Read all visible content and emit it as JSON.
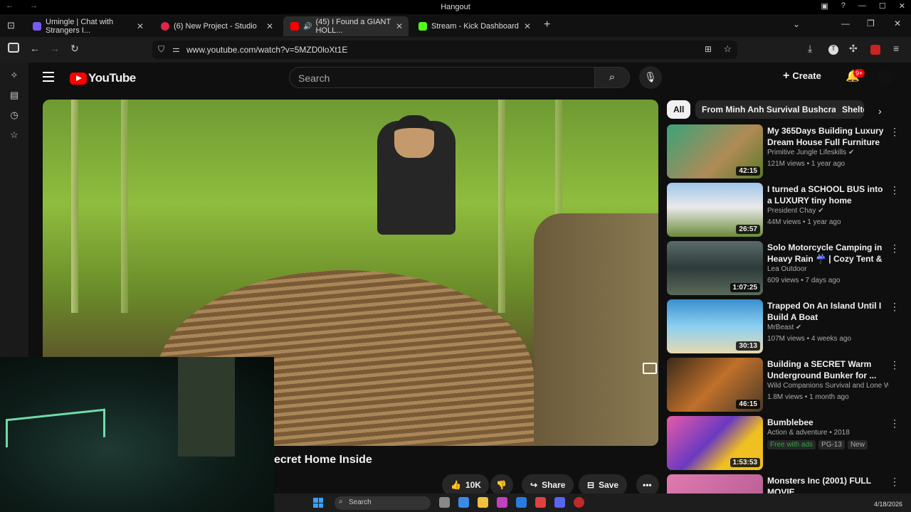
{
  "window": {
    "title": "Hangout"
  },
  "tabs": [
    {
      "label": "Umingle | Chat with Strangers I...",
      "color": "#7a5af5"
    },
    {
      "label": "(6) New Project - Studio",
      "color": "#e0244a"
    },
    {
      "label": "(45) I Found a GIANT HOLL...",
      "color": "#ff0000"
    },
    {
      "label": "Stream - Kick Dashboard",
      "color": "#53fc18"
    }
  ],
  "address": {
    "url": "www.youtube.com/watch?v=5MZD0loXt1E"
  },
  "youtube": {
    "logo_text": "YouTube",
    "search_placeholder": "Search",
    "create_label": "Create",
    "notification_count": "9+"
  },
  "video": {
    "title_partial": "ecret Home Inside",
    "like_count": "10K",
    "share_label": "Share",
    "save_label": "Save"
  },
  "chips": [
    "All",
    "From Minh Anh Survival Bushcraft",
    "Shelte"
  ],
  "recommendations": [
    {
      "title": "My 365Days Building Luxury Dream House Full Furniture an...",
      "channel": "Primitive Jungle Lifeskills",
      "verified": true,
      "meta": "121M views • 1 year ago",
      "duration": "42:15"
    },
    {
      "title": "I turned a SCHOOL BUS into a LUXURY tiny home",
      "channel": "President Chay",
      "verified": true,
      "meta": "44M views • 1 year ago",
      "duration": "26:57"
    },
    {
      "title": "Solo Motorcycle Camping in Heavy Rain ☔ | Cozy Tent & ...",
      "channel": "Lea Outdoor",
      "verified": false,
      "meta": "609 views • 7 days ago",
      "duration": "1:07:25"
    },
    {
      "title": "Trapped On An Island Until I Build A Boat",
      "channel": "MrBeast",
      "verified": true,
      "meta": "107M views • 4 weeks ago",
      "duration": "30:13"
    },
    {
      "title": "Building a SECRET Warm Underground Bunker for ...",
      "channel": "Wild Companions Survival and Lone Wo...",
      "verified": false,
      "meta": "1.8M views • 1 month ago",
      "duration": "46:15"
    },
    {
      "title": "Bumblebee",
      "channel": "Action & adventure • 2018",
      "verified": false,
      "meta": "",
      "duration": "1:53:53",
      "tags": [
        "Free with ads",
        "PG-13",
        "New"
      ]
    },
    {
      "title": "Monsters Inc (2001) FULL MOVIE",
      "channel": "",
      "verified": false,
      "meta": "",
      "duration": ""
    }
  ],
  "taskbar": {
    "search_label": "Search",
    "date": "4/18/2026"
  }
}
